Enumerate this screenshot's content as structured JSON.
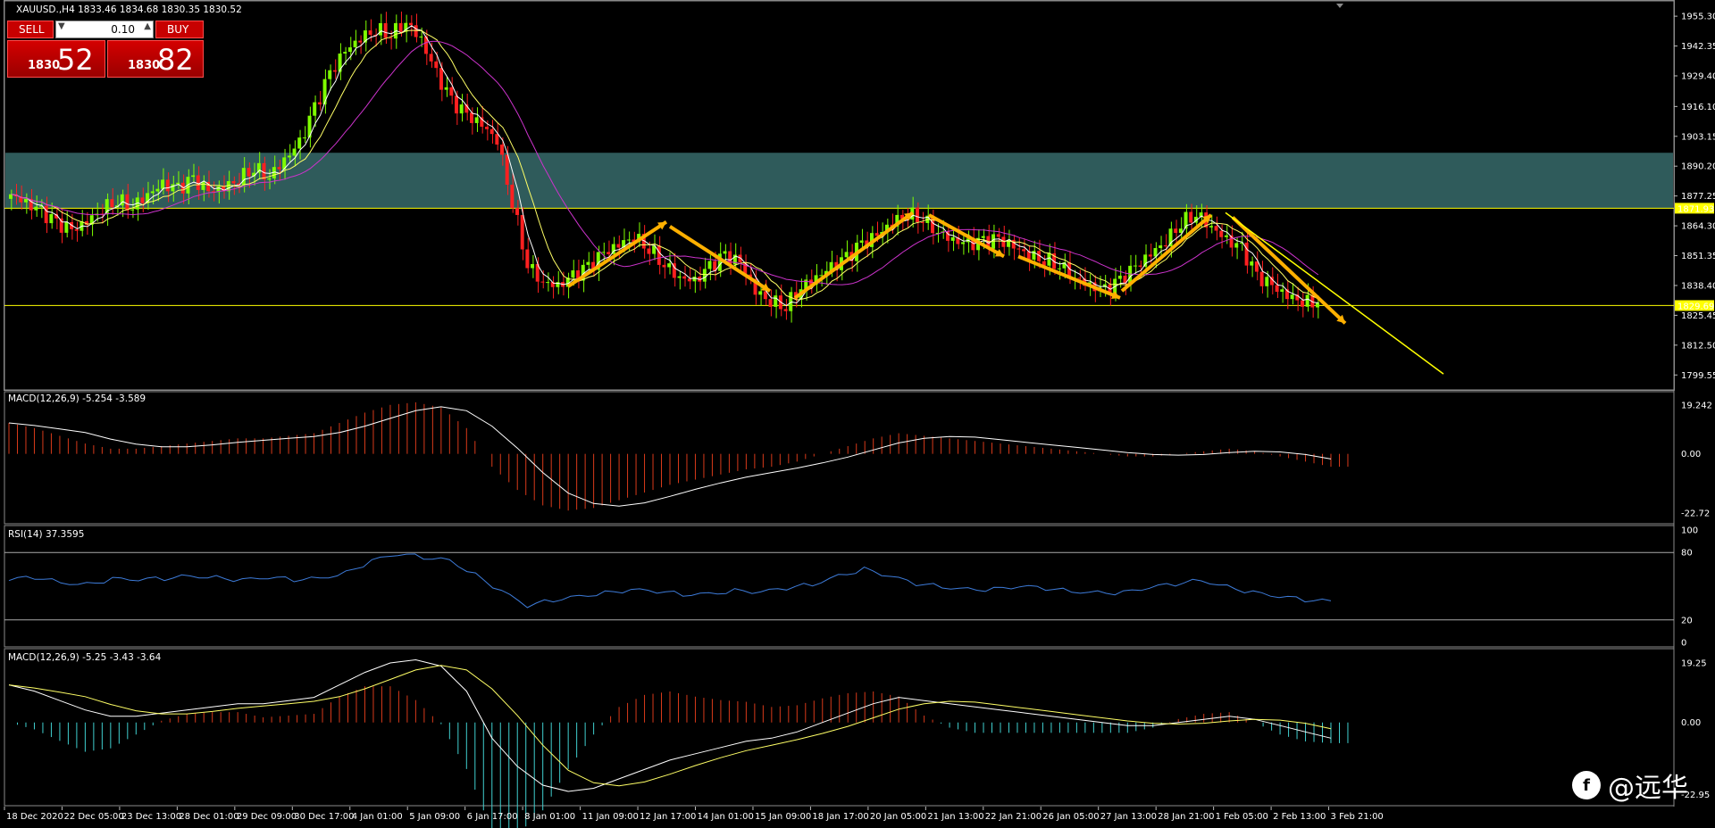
{
  "symbol_caption": "XAUUSD.,H4  1833.46 1834.68 1830.35 1830.52",
  "trade_panel": {
    "sell_label": "SELL",
    "buy_label": "BUY",
    "lot_value": "0.10",
    "sell_price_prefix": "1830",
    "sell_price_big": "52",
    "buy_price_prefix": "1830",
    "buy_price_big": "82"
  },
  "indicators": {
    "macd1_label": "MACD(12,26,9) -5.254 -3.589",
    "rsi_label": "RSI(14) 37.3595",
    "macd2_label": "MACD(12,26,9) -5.25 -3.43 -3.64"
  },
  "price_axis": {
    "ticks": [
      "1955.30",
      "1942.35",
      "1929.40",
      "1916.10",
      "1903.15",
      "1890.20",
      "1877.25",
      "1864.30",
      "1851.35",
      "1838.40",
      "1825.45",
      "1812.50",
      "1799.55"
    ],
    "level_upper": "1871.93",
    "level_lower": "1829.69"
  },
  "macd1_axis": {
    "ticks": [
      "19.242",
      "0.00",
      "-22.72"
    ]
  },
  "rsi_axis": {
    "ticks": [
      "100",
      "80",
      "20",
      "0"
    ]
  },
  "macd2_axis": {
    "ticks": [
      "19.25",
      "0.00",
      "-22.95"
    ]
  },
  "time_axis": {
    "labels": [
      "18 Dec 2020",
      "22 Dec 05:00",
      "23 Dec 13:00",
      "28 Dec 01:00",
      "29 Dec 09:00",
      "30 Dec 17:00",
      "4 Jan 01:00",
      "5 Jan 09:00",
      "6 Jan 17:00",
      "8 Jan 01:00",
      "11 Jan 09:00",
      "12 Jan 17:00",
      "14 Jan 01:00",
      "15 Jan 09:00",
      "18 Jan 17:00",
      "20 Jan 05:00",
      "21 Jan 13:00",
      "22 Jan 21:00",
      "26 Jan 05:00",
      "27 Jan 13:00",
      "28 Jan 21:00",
      "1 Feb 05:00",
      "2 Feb 13:00",
      "3 Feb 21:00"
    ]
  },
  "watermark": {
    "text": "@远华",
    "mark": "f"
  },
  "colors": {
    "bull": "#7fff00",
    "bear": "#ff2020",
    "zone": "#2f5b5b",
    "level": "#ffff00",
    "ma_fast": "#ffffff",
    "ma_mid": "#ffff66",
    "ma_slow": "#cc33cc",
    "arrow": "#ffb000",
    "rsi": "#3d7bd9",
    "macd_hist": "#d83a1a",
    "macd_hist_neg": "#40d0d0"
  },
  "chart_data": {
    "type": "line",
    "title": "XAUUSD.,H4",
    "price_range": [
      1799.55,
      1960
    ],
    "close": [
      1878,
      1874,
      1870,
      1865,
      1862,
      1866,
      1872,
      1876,
      1873,
      1878,
      1882,
      1880,
      1884,
      1879,
      1881,
      1885,
      1890,
      1886,
      1893,
      1900,
      1915,
      1930,
      1940,
      1946,
      1950,
      1948,
      1953,
      1945,
      1930,
      1918,
      1912,
      1908,
      1902,
      1875,
      1848,
      1840,
      1838,
      1842,
      1846,
      1852,
      1856,
      1860,
      1855,
      1848,
      1842,
      1840,
      1846,
      1851,
      1848,
      1836,
      1832,
      1830,
      1838,
      1842,
      1846,
      1850,
      1856,
      1860,
      1866,
      1870,
      1868,
      1862,
      1858,
      1856,
      1857,
      1858,
      1855,
      1852,
      1850,
      1848,
      1842,
      1838,
      1836,
      1840,
      1846,
      1852,
      1858,
      1866,
      1870,
      1864,
      1858,
      1854,
      1842,
      1838,
      1834,
      1832,
      1831
    ],
    "macd_line": [
      12,
      10,
      7,
      4,
      2,
      2,
      3,
      4,
      5,
      6,
      6,
      7,
      8,
      12,
      16,
      19,
      20,
      18,
      10,
      -5,
      -14,
      -20,
      -22,
      -21,
      -18,
      -15,
      -12,
      -10,
      -8,
      -6,
      -5,
      -3,
      0,
      3,
      6,
      8,
      7,
      6,
      5,
      4,
      3,
      2,
      1,
      0,
      -1,
      -1,
      0,
      1,
      2,
      1,
      -1,
      -3,
      -5
    ],
    "rsi": [
      55,
      58,
      54,
      52,
      56,
      55,
      57,
      60,
      58,
      55,
      57,
      56,
      58,
      62,
      72,
      78,
      76,
      74,
      60,
      45,
      32,
      38,
      42,
      44,
      46,
      45,
      43,
      44,
      46,
      44,
      48,
      52,
      60,
      65,
      58,
      52,
      50,
      48,
      47,
      49,
      48,
      46,
      45,
      44,
      48,
      52,
      56,
      50,
      44,
      40,
      38,
      37
    ],
    "series": [
      {
        "name": "MACD(12,26,9)",
        "last": -5.254
      },
      {
        "name": "RSI(14)",
        "last": 37.3595
      }
    ]
  }
}
